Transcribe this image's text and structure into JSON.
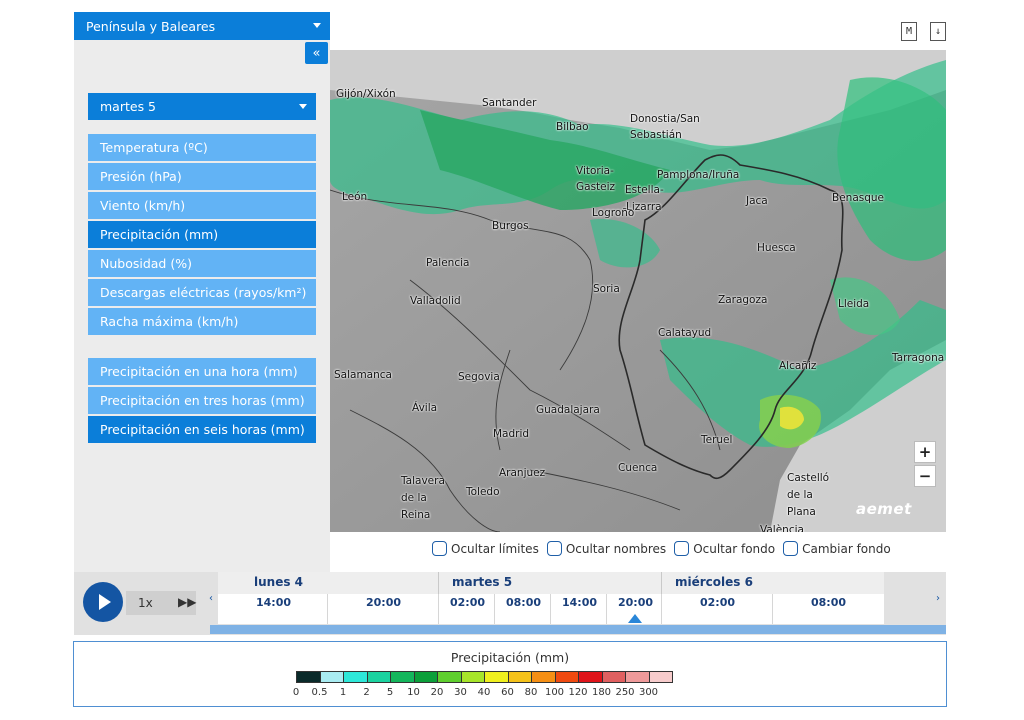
{
  "sidebar": {
    "region": "Península y Baleares",
    "collapse_label": "«",
    "date": "martes 5",
    "variables": [
      {
        "label": "Temperatura (ºC)",
        "active": false
      },
      {
        "label": "Presión (hPa)",
        "active": false
      },
      {
        "label": "Viento (km/h)",
        "active": false
      },
      {
        "label": "Precipitación (mm)",
        "active": true
      },
      {
        "label": "Nubosidad (%)",
        "active": false
      },
      {
        "label": "Descargas eléctricas (rayos/km²)",
        "active": false
      },
      {
        "label": "Racha máxima (km/h)",
        "active": false
      }
    ],
    "accumulations": [
      {
        "label": "Precipitación en una hora (mm)",
        "active": false
      },
      {
        "label": "Precipitación en tres horas (mm)",
        "active": false
      },
      {
        "label": "Precipitación en seis horas (mm)",
        "active": true
      }
    ]
  },
  "top_icons": {
    "map_label": "M",
    "download_label": "↓"
  },
  "map": {
    "cities": [
      "Gijón/Xixón",
      "Santander",
      "Bilbao",
      "Donostia/San",
      "Sebastián",
      "Vitoria-",
      "Gasteiz",
      "Pamplona/Iruña",
      "Estella-",
      "Lizarra",
      "Logroño",
      "León",
      "Burgos",
      "Jaca",
      "Benasque",
      "Huesca",
      "Palencia",
      "Soria",
      "Valladolid",
      "Zaragoza",
      "Lleida",
      "Calatayud",
      "Tarragona",
      "Alcañiz",
      "Salamanca",
      "Segovia",
      "Ávila",
      "Guadalajara",
      "Madrid",
      "Teruel",
      "Aranjuez",
      "Cuenca",
      "Talavera",
      "de la",
      "Reina",
      "Toledo",
      "Castelló",
      "de la",
      "Plana",
      "València"
    ],
    "zoom_in": "+",
    "zoom_out": "−",
    "logo": "aemet"
  },
  "map_options": [
    "Ocultar límites",
    "Ocultar nombres",
    "Ocultar fondo",
    "Cambiar fondo"
  ],
  "timeline": {
    "speed": "1x",
    "fast_forward": "▶▶",
    "prev": "‹",
    "next": "›",
    "days": [
      "lunes 4",
      "martes 5",
      "miércoles 6"
    ],
    "hours": [
      "14:00",
      "20:00",
      "02:00",
      "08:00",
      "14:00",
      "20:00",
      "02:00",
      "08:00"
    ],
    "selected_hour_index": 5
  },
  "legend": {
    "title": "Precipitación (mm)",
    "levels": [
      "0",
      "0.5",
      "1",
      "2",
      "5",
      "10",
      "20",
      "30",
      "40",
      "60",
      "80",
      "100",
      "120",
      "180",
      "250",
      "300"
    ],
    "colors": [
      "#0a2a2a",
      "#a9ecf2",
      "#2ee8d9",
      "#1bd3a0",
      "#14b65c",
      "#0b9f3a",
      "#5fcf2e",
      "#a7e52a",
      "#f0f01e",
      "#f5c21a",
      "#f58f14",
      "#f04a10",
      "#e0141a",
      "#e06060",
      "#ef9a9a",
      "#f7cccc"
    ]
  }
}
